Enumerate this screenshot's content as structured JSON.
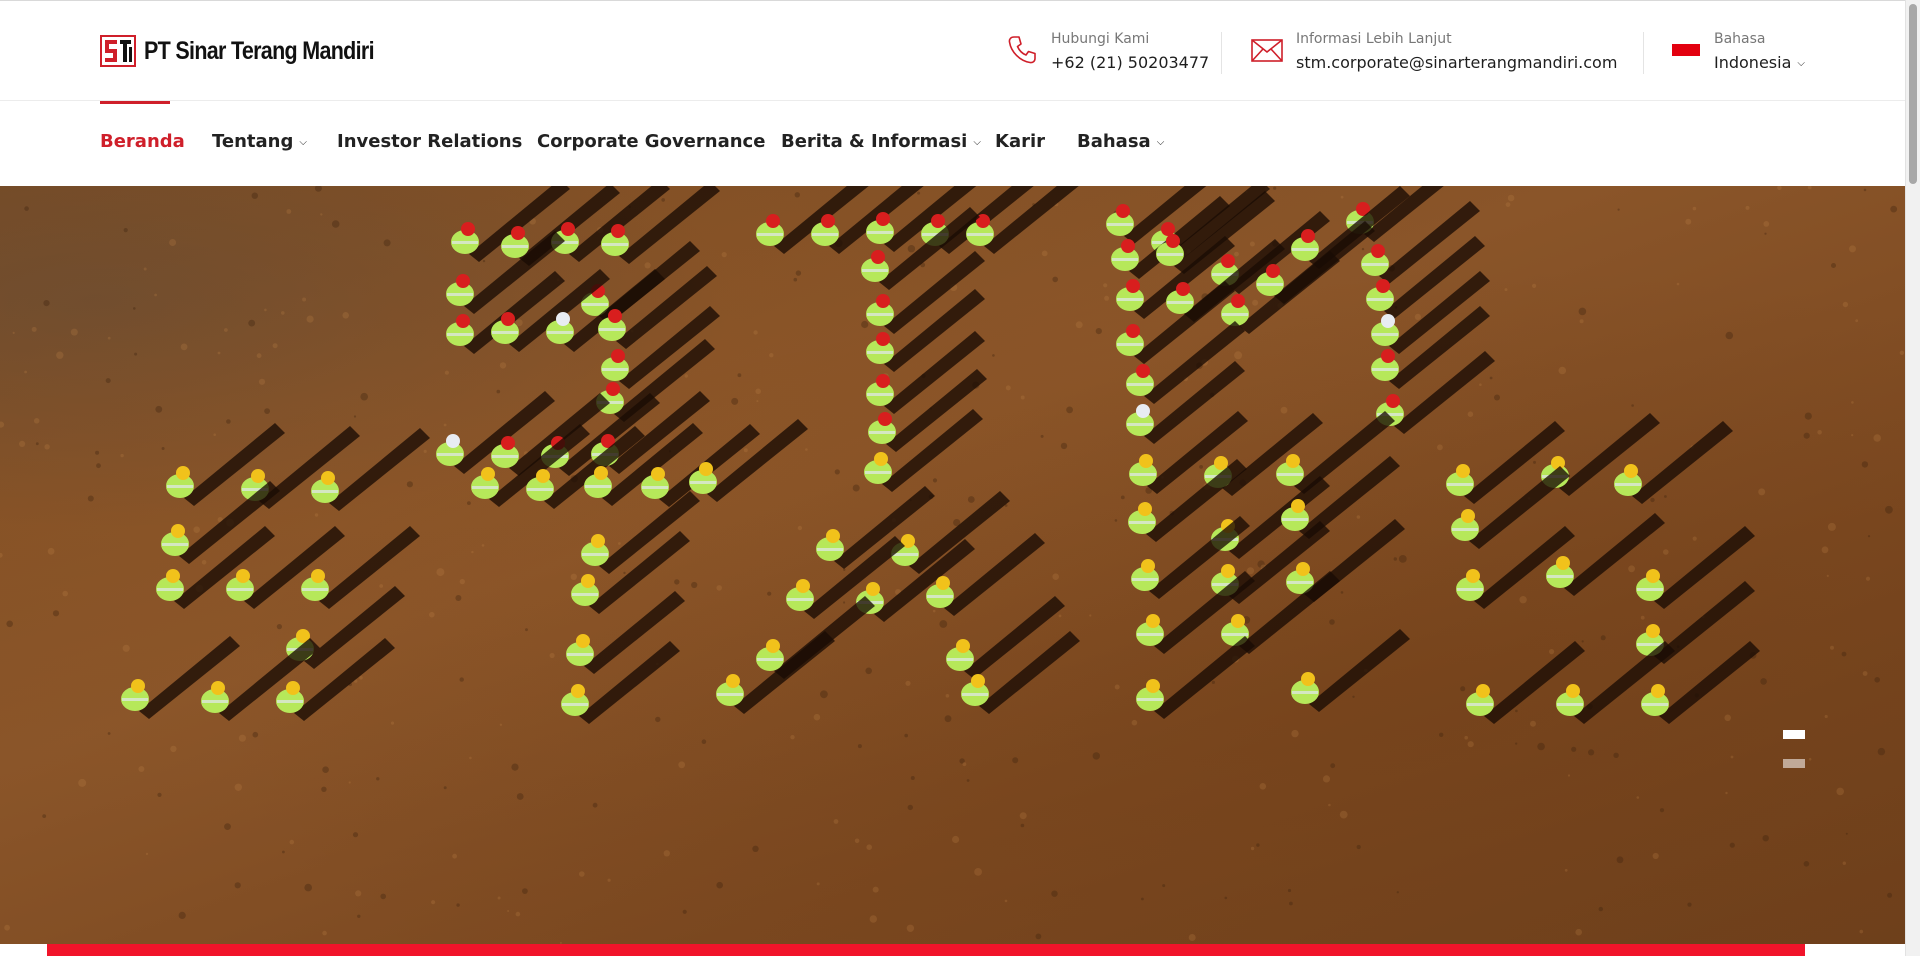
{
  "brand": {
    "name": "PT Sinar Terang Mandiri",
    "mark_letters": "STM",
    "color": "#cf1f2a"
  },
  "contacts": {
    "phone": {
      "label": "Hubungi Kami",
      "value": "+62 (21) 50203477",
      "icon": "phone-icon"
    },
    "email": {
      "label": "Informasi Lebih Lanjut",
      "value": "stm.corporate@sinarterangmandiri.com",
      "icon": "envelope-icon"
    },
    "language": {
      "label": "Bahasa",
      "value": "Indonesia",
      "icon": "indonesia-flag-icon"
    }
  },
  "nav": {
    "items": [
      {
        "label": "Beranda",
        "active": true,
        "dropdown": false
      },
      {
        "label": "Tentang",
        "active": false,
        "dropdown": true
      },
      {
        "label": "Investor Relations",
        "active": false,
        "dropdown": false
      },
      {
        "label": "Corporate Governance",
        "active": false,
        "dropdown": false
      },
      {
        "label": "Berita & Informasi",
        "active": false,
        "dropdown": true
      },
      {
        "label": "Karir",
        "active": false,
        "dropdown": false
      },
      {
        "label": "Bahasa",
        "active": false,
        "dropdown": true
      }
    ]
  },
  "hero": {
    "image": "aerial photo of workers in high-visibility vests and hard hats standing on brown soil",
    "slide_count": 2,
    "active_slide": 1
  },
  "colors": {
    "accent": "#cf1f2a",
    "progress": "#f1142a",
    "soil": "#7f4d23",
    "vest": "#b6e85a"
  }
}
